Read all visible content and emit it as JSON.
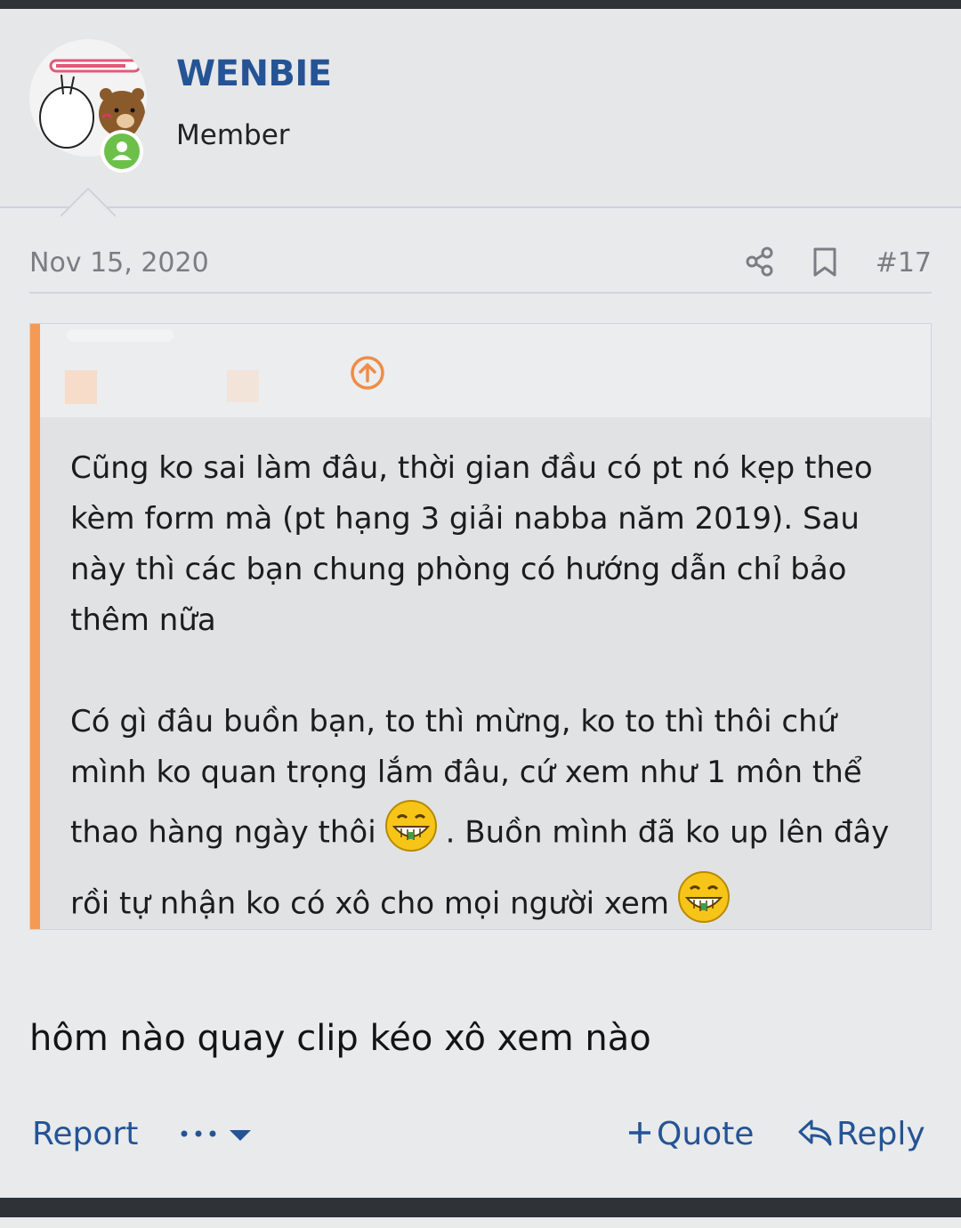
{
  "user": {
    "username": "WENBIE",
    "role": "Member",
    "online": true
  },
  "post": {
    "date": "Nov 15, 2020",
    "number": "#17",
    "quote": {
      "author": "",
      "paragraph1": "Cũng ko sai làm đâu, thời gian đầu có pt nó kẹp theo kèm form mà (pt hạng 3 giải nabba năm 2019). Sau này thì các bạn chung phòng có hướng dẫn chỉ bảo thêm nữa",
      "paragraph2_a": "Có gì đâu buồn bạn, to thì mừng, ko to thì thôi chứ mình ko quan trọng lắm đâu, cứ xem như 1 môn thể thao hàng ngày thôi",
      "paragraph2_b": ". Buồn mình đã ko up lên đây rồi tự nhận ko có xô cho mọi người xem"
    },
    "reply": "hôm nào quay clip kéo xô xem nào"
  },
  "actions": {
    "report": "Report",
    "more": "•••",
    "quote": "Quote",
    "quote_prefix": "+",
    "reply": "Reply"
  },
  "colors": {
    "accent": "#245495",
    "quote_bar": "#f59a54",
    "online": "#6cc04a",
    "dark_bar": "#2f3338"
  }
}
